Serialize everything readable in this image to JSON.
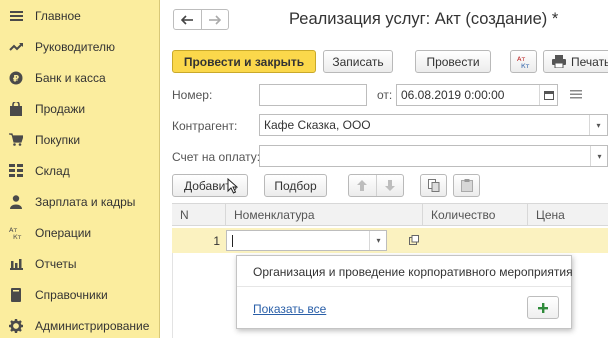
{
  "sidebar": {
    "items": [
      {
        "label": "Главное",
        "icon": "menu-lines-icon"
      },
      {
        "label": "Руководителю",
        "icon": "trend-icon"
      },
      {
        "label": "Банк и касса",
        "icon": "ruble-coin-icon"
      },
      {
        "label": "Продажи",
        "icon": "shopping-bag-icon"
      },
      {
        "label": "Покупки",
        "icon": "cart-icon"
      },
      {
        "label": "Склад",
        "icon": "warehouse-icon"
      },
      {
        "label": "Зарплата и кадры",
        "icon": "person-icon"
      },
      {
        "label": "Операции",
        "icon": "dt-kt-icon"
      },
      {
        "label": "Отчеты",
        "icon": "bar-chart-icon"
      },
      {
        "label": "Справочники",
        "icon": "book-icon"
      },
      {
        "label": "Администрирование",
        "icon": "gear-icon"
      }
    ],
    "icon_glyphs": {
      "dt_kt": "Ат\nКт"
    }
  },
  "header": {
    "title": "Реализация услуг: Акт (создание) *"
  },
  "toolbar": {
    "post_close_label": "Провести и закрыть",
    "save_label": "Записать",
    "post_label": "Провести",
    "dtkt_label": "Ат Кт",
    "print_label": "Печать"
  },
  "form": {
    "number_label": "Номер:",
    "number_value": "",
    "from_label": "от:",
    "date_value": "06.08.2019  0:00:00",
    "contractor_label": "Контрагент:",
    "contractor_value": "Кафе Сказка, ООО",
    "invoice_label": "Счет на оплату:",
    "invoice_value": ""
  },
  "table_toolbar": {
    "add_label": "Добавить",
    "select_label": "Подбор"
  },
  "table": {
    "columns": [
      "N",
      "Номенклатура",
      "Количество",
      "Цена"
    ],
    "rows": [
      {
        "n": "1",
        "nomenclature": "",
        "quantity": "",
        "price": ""
      }
    ]
  },
  "dropdown": {
    "items": [
      "Организация и проведение корпоративного мероприятия"
    ],
    "show_all_label": "Показать все"
  },
  "colors": {
    "sidebar_bg": "#fbed9e",
    "primary_button": "#fbd84b",
    "selected_row": "#fbf2c0",
    "link": "#2a5fa8",
    "add_plus": "#2e8b3a"
  }
}
